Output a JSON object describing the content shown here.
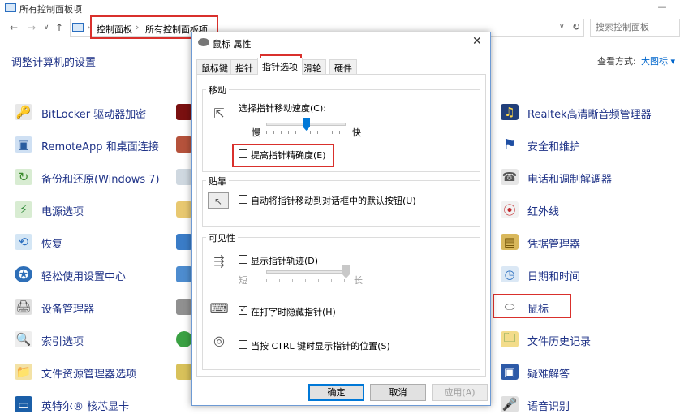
{
  "window": {
    "title": "所有控制面板项",
    "minimize_glyph": "—"
  },
  "nav": {
    "back": "←",
    "forward": "→",
    "dropdown": "∨",
    "up": "↑"
  },
  "address": {
    "crumbs": [
      "控制面板",
      "所有控制面板项"
    ],
    "separator": "›",
    "dropdown": "∨",
    "refresh": "↻"
  },
  "search": {
    "placeholder": "搜索控制面板"
  },
  "content": {
    "heading": "调整计算机的设置",
    "view_by_label": "查看方式:",
    "view_by_value": "大图标 ▾"
  },
  "left_items": [
    {
      "label": "BitLocker 驱动器加密",
      "icon": "bitlocker-icon"
    },
    {
      "label": "RemoteApp 和桌面连接",
      "icon": "remoteapp-icon"
    },
    {
      "label": "备份和还原(Windows 7)",
      "icon": "backup-icon"
    },
    {
      "label": "电源选项",
      "icon": "power-icon"
    },
    {
      "label": "恢复",
      "icon": "recovery-icon"
    },
    {
      "label": "轻松使用设置中心",
      "icon": "ease-of-access-icon"
    },
    {
      "label": "设备管理器",
      "icon": "device-manager-icon"
    },
    {
      "label": "索引选项",
      "icon": "indexing-icon"
    },
    {
      "label": "文件资源管理器选项",
      "icon": "explorer-options-icon"
    },
    {
      "label": "英特尔® 核芯显卡",
      "icon": "intel-graphics-icon"
    }
  ],
  "right_items": [
    {
      "label": "Realtek高清晰音频管理器",
      "icon": "realtek-audio-icon"
    },
    {
      "label": "安全和维护",
      "icon": "security-flag-icon"
    },
    {
      "label": "电话和调制解调器",
      "icon": "phone-modem-icon"
    },
    {
      "label": "红外线",
      "icon": "infrared-icon"
    },
    {
      "label": "凭据管理器",
      "icon": "credential-icon"
    },
    {
      "label": "日期和时间",
      "icon": "date-time-icon"
    },
    {
      "label": "鼠标",
      "icon": "mouse-icon"
    },
    {
      "label": "文件历史记录",
      "icon": "file-history-icon"
    },
    {
      "label": "疑难解答",
      "icon": "troubleshoot-icon"
    },
    {
      "label": "语音识别",
      "icon": "speech-icon"
    }
  ],
  "dialog": {
    "title": "鼠标 属性",
    "close": "✕",
    "tabs": [
      "鼠标键",
      "指针",
      "指针选项",
      "滑轮",
      "硬件"
    ],
    "active_tab": 2,
    "motion": {
      "group_title": "移动",
      "speed_label": "选择指针移动速度(C):",
      "slow": "慢",
      "fast": "快",
      "speed_value_fraction": 0.5,
      "precision_label": "提高指针精确度(E)",
      "precision_checked": false
    },
    "snap": {
      "group_title": "贴靠",
      "label": "自动将指针移动到对话框中的默认按钮(U)",
      "checked": false
    },
    "visibility": {
      "group_title": "可见性",
      "trails_label": "显示指针轨迹(D)",
      "trails_checked": false,
      "short": "短",
      "long": "长",
      "trail_length_fraction": 1.0,
      "hide_label": "在打字时隐藏指针(H)",
      "hide_checked": true,
      "ctrl_label": "当按 CTRL 键时显示指针的位置(S)",
      "ctrl_checked": false
    },
    "buttons": {
      "ok": "确定",
      "cancel": "取消",
      "apply": "应用(A)"
    }
  },
  "colors": {
    "link": "#1e3287",
    "highlight": "#d9302c",
    "accent": "#0078d7"
  }
}
